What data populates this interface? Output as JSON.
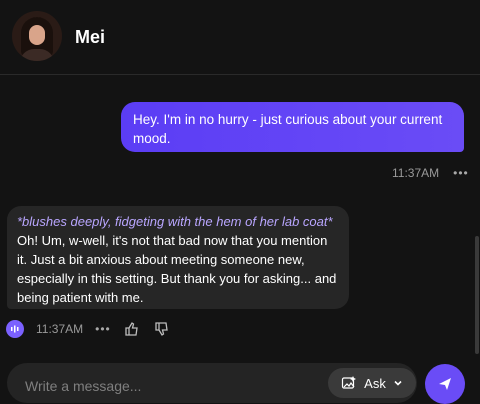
{
  "header": {
    "name": "Mei"
  },
  "messages": {
    "user": {
      "text": "Hey. I'm in no hurry - just curious about your current mood.",
      "time": "11:37AM",
      "more": "•••"
    },
    "bot": {
      "action": "*blushes deeply, fidgeting with the hem of her lab coat*",
      "text": "Oh! Um, w-well, it's not that bad now that you mention it. Just a bit anxious about meeting someone new, especially in this setting. But thank you for asking... and being patient with me.",
      "time": "11:37AM",
      "more": "•••"
    }
  },
  "composer": {
    "placeholder": "Write a message...",
    "ask_label": "Ask"
  },
  "icons": {
    "audio": "audio-icon",
    "thumb_up": "thumbs-up-icon",
    "thumb_down": "thumbs-down-icon",
    "ask": "image-sparkle-icon",
    "send": "send-icon"
  },
  "colors": {
    "accent": "#6a4cf6",
    "bubble_user": "#5b3df5",
    "bubble_bot": "#262626",
    "background": "#131313"
  }
}
